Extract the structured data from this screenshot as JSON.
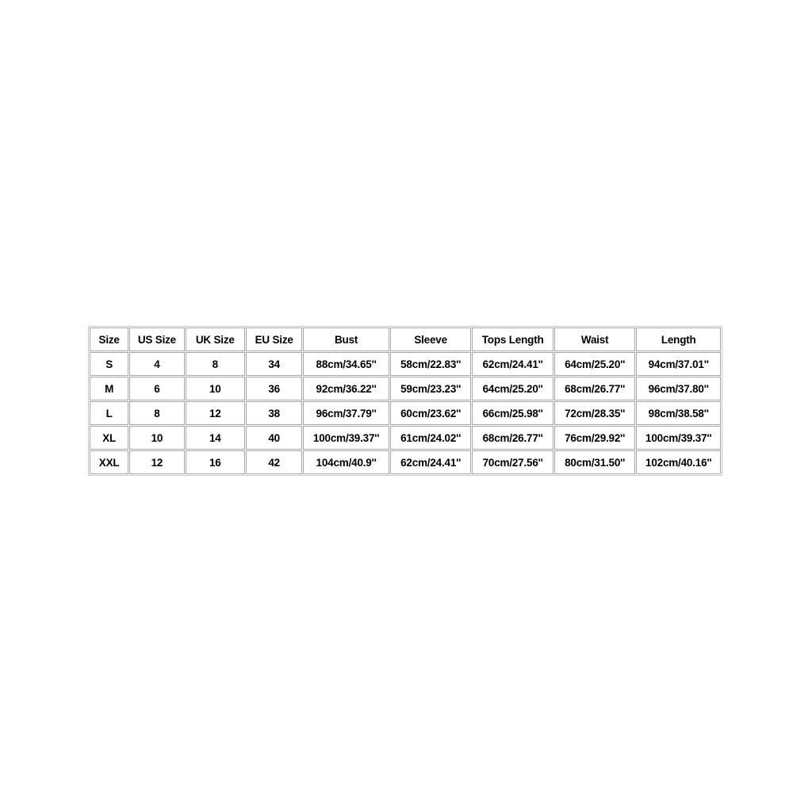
{
  "table": {
    "name": "Size Chart",
    "headers": [
      "Size",
      "US Size",
      "UK Size",
      "EU Size",
      "Bust",
      "Sleeve",
      "Tops Length",
      "Waist",
      "Length"
    ],
    "rows": [
      {
        "size": "S",
        "us_size": "4",
        "uk_size": "8",
        "eu_size": "34",
        "bust": "88cm/34.65''",
        "sleeve": "58cm/22.83''",
        "tops_length": "62cm/24.41''",
        "waist": "64cm/25.20''",
        "length": "94cm/37.01''"
      },
      {
        "size": "M",
        "us_size": "6",
        "uk_size": "10",
        "eu_size": "36",
        "bust": "92cm/36.22''",
        "sleeve": "59cm/23.23''",
        "tops_length": "64cm/25.20''",
        "waist": "68cm/26.77''",
        "length": "96cm/37.80''"
      },
      {
        "size": "L",
        "us_size": "8",
        "uk_size": "12",
        "eu_size": "38",
        "bust": "96cm/37.79''",
        "sleeve": "60cm/23.62''",
        "tops_length": "66cm/25.98''",
        "waist": "72cm/28.35''",
        "length": "98cm/38.58''"
      },
      {
        "size": "XL",
        "us_size": "10",
        "uk_size": "14",
        "eu_size": "40",
        "bust": "100cm/39.37''",
        "sleeve": "61cm/24.02''",
        "tops_length": "68cm/26.77''",
        "waist": "76cm/29.92''",
        "length": "100cm/39.37''"
      },
      {
        "size": "XXL",
        "us_size": "12",
        "uk_size": "16",
        "eu_size": "42",
        "bust": "104cm/40.9''",
        "sleeve": "62cm/24.41''",
        "tops_length": "70cm/27.56''",
        "waist": "80cm/31.50''",
        "length": "102cm/40.16''"
      }
    ]
  },
  "colors": {
    "background": "#ffffff",
    "text": "#000000",
    "cell_border": "#a8a8a8",
    "outer_border": "#c9c9c9"
  }
}
